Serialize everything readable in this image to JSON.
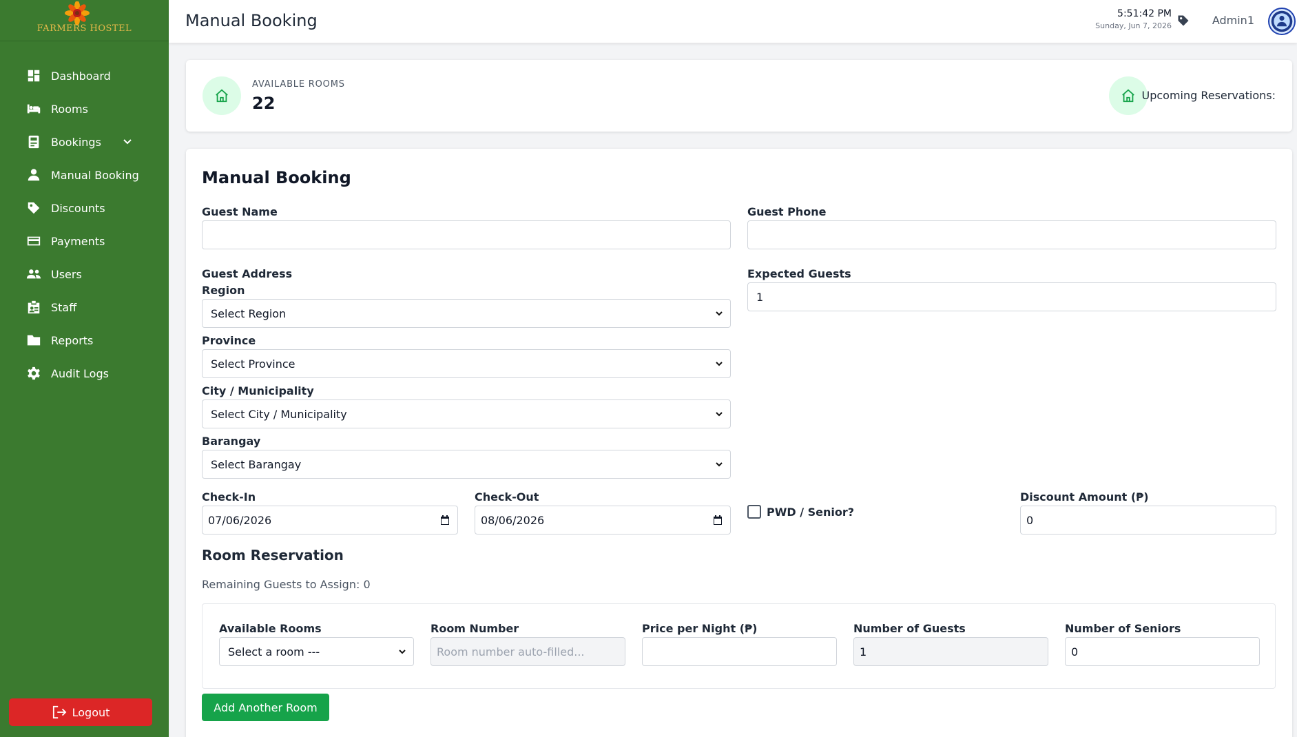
{
  "brand": {
    "name": "FARMERS HOSTEL"
  },
  "sidebar": {
    "items": [
      {
        "label": "Dashboard",
        "icon": "dashboard-icon"
      },
      {
        "label": "Rooms",
        "icon": "bed-icon"
      },
      {
        "label": "Bookings",
        "icon": "booking-icon"
      },
      {
        "label": "Manual Booking",
        "icon": "user-icon"
      },
      {
        "label": "Discounts",
        "icon": "tag-icon"
      },
      {
        "label": "Payments",
        "icon": "credit-card-icon"
      },
      {
        "label": "Users",
        "icon": "users-icon"
      },
      {
        "label": "Staff",
        "icon": "id-badge-icon"
      },
      {
        "label": "Reports",
        "icon": "folder-icon"
      },
      {
        "label": "Audit Logs",
        "icon": "gear-icon"
      }
    ],
    "logout_label": "Logout"
  },
  "header": {
    "title": "Manual Booking",
    "time": "5:51:42 PM",
    "date": "Sunday, Jun 7, 2026",
    "user": "Admin1"
  },
  "stats": {
    "available_label": "AVAILABLE ROOMS",
    "available_value": "22",
    "upcoming_label": "Upcoming Reservations:"
  },
  "form": {
    "title": "Manual Booking",
    "guest_name_label": "Guest Name",
    "guest_name_value": "",
    "guest_phone_label": "Guest Phone",
    "guest_phone_value": "",
    "guest_address_label": "Guest Address",
    "region_label": "Region",
    "region_value": "Select Region",
    "province_label": "Province",
    "province_value": "Select Province",
    "city_label": "City / Municipality",
    "city_value": "Select City / Municipality",
    "barangay_label": "Barangay",
    "barangay_value": "Select Barangay",
    "expected_guests_label": "Expected Guests",
    "expected_guests_value": "1",
    "checkin_label": "Check-In",
    "checkin_value": "07/06/2026",
    "checkout_label": "Check-Out",
    "checkout_value": "08/06/2026",
    "pwd_label": "PWD / Senior?",
    "pwd_checked": false,
    "discount_label": "Discount Amount (₱)",
    "discount_value": "0"
  },
  "room_reservation": {
    "title": "Room Reservation",
    "remaining": "Remaining Guests to Assign: 0",
    "available_rooms_label": "Available Rooms",
    "available_rooms_value": "Select a room ---",
    "room_number_label": "Room Number",
    "room_number_placeholder": "Room number auto-filled...",
    "price_label": "Price per Night (₱)",
    "price_value": "",
    "num_guests_label": "Number of Guests",
    "num_guests_value": "1",
    "num_seniors_label": "Number of Seniors",
    "num_seniors_value": "0",
    "add_room_label": "Add Another Room"
  },
  "colors": {
    "sidebar": "#3b7a2f",
    "accent_green": "#16a34a",
    "logout_red": "#dc2626"
  }
}
